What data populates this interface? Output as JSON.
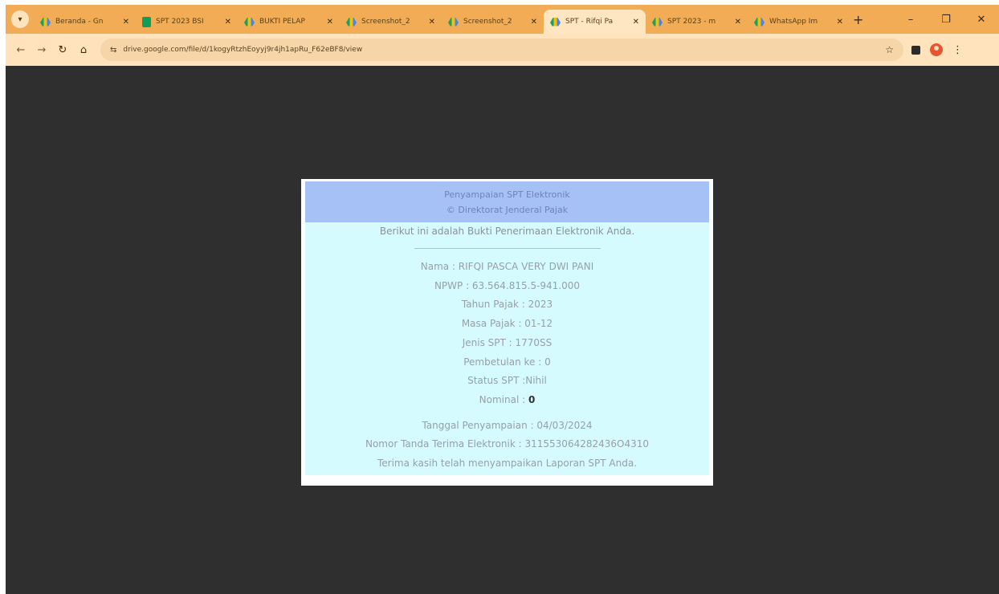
{
  "browser": {
    "tabs": [
      {
        "label": "Beranda - Gn",
        "icon": "drive-icon",
        "active": false
      },
      {
        "label": "SPT 2023 BSI",
        "icon": "sheets-icon",
        "active": false
      },
      {
        "label": "BUKTI PELAP",
        "icon": "drive-icon",
        "active": false
      },
      {
        "label": "Screenshot_2",
        "icon": "drive-icon",
        "active": false
      },
      {
        "label": "Screenshot_2",
        "icon": "drive-icon",
        "active": false
      },
      {
        "label": "SPT - Rifqi Pa",
        "icon": "drive-icon",
        "active": true
      },
      {
        "label": "SPT 2023 - m",
        "icon": "drive-icon",
        "active": false
      },
      {
        "label": "WhatsApp Im",
        "icon": "drive-icon",
        "active": false
      }
    ],
    "url": "drive.google.com/file/d/1kogyRtzhEoyyj9r4jh1apRu_F62eBF8/view",
    "colors": {
      "frame": "#f2ac55",
      "toolbar": "#ffe3bd",
      "viewer_bg": "#2f2f2f"
    }
  },
  "receipt": {
    "header_line1": "Penyampaian SPT Elektronik",
    "header_line2": "© Direktorat Jenderal Pajak",
    "intro": "Berikut ini adalah Bukti Penerimaan Elektronik Anda.",
    "nama": "Nama : RIFQI PASCA VERY DWI PANI",
    "npwp": "NPWP : 63.564.815.5-941.000",
    "tahun": "Tahun Pajak : 2023",
    "masa": "Masa Pajak : 01-12",
    "jenis": "Jenis SPT : 1770SS",
    "pembetulan": "Pembetulan ke : 0",
    "status": "Status SPT :Nihil",
    "nominal_label": "Nominal : ",
    "nominal_value": "0",
    "tanggal": "Tanggal Penyampaian : 04/03/2024",
    "ntte": "Nomor Tanda Terima Elektronik : 311553064282436O4310",
    "thanks": "Terima kasih telah menyampaikan Laporan SPT Anda.",
    "colors": {
      "header_bg": "#a5c1f6",
      "body_bg": "#d6fbfe"
    }
  }
}
